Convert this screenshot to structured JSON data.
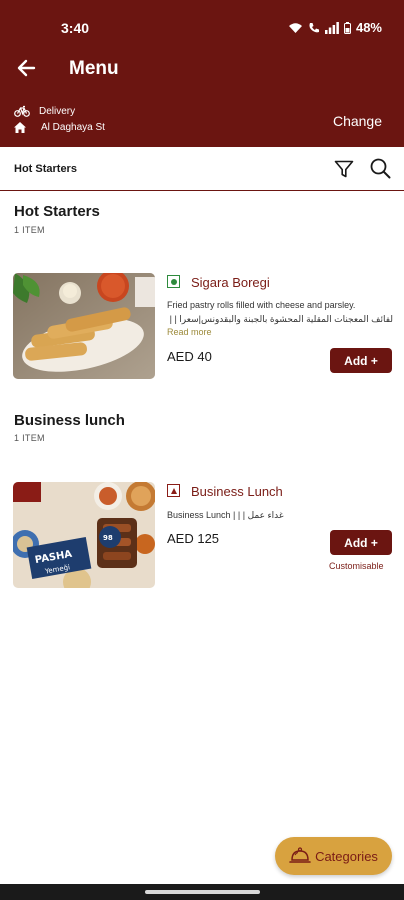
{
  "status_bar": {
    "time": "3:40",
    "battery": "48%"
  },
  "appbar": {
    "title": "Menu"
  },
  "delivery": {
    "mode": "Delivery",
    "address": "Al Daghaya St",
    "change_label": "Change"
  },
  "searchbar": {
    "label": "Hot Starters"
  },
  "sections": [
    {
      "title": "Hot Starters",
      "count": "1 ITEM",
      "item": {
        "name": "Sigara Boregi",
        "diet": "veg",
        "desc_line1": "Fried pastry rolls filled with cheese and parsley.",
        "desc_line2": "لفائف المعجنات المقلية المحشوة بالجبنة والبقدونس|سعرا | | |",
        "read_more": "Read more",
        "price": "AED 40",
        "add_label": "Add +"
      }
    },
    {
      "title": "Business lunch",
      "count": "1 ITEM",
      "item": {
        "name": "Business Lunch",
        "diet": "non-veg",
        "desc_line1": "Business Lunch | | | غداء عمل",
        "price": "AED 125",
        "add_label": "Add +",
        "note": "Customisable",
        "image_text": "PASHA Yemeği"
      }
    }
  ],
  "categories_label": "Categories",
  "colors": {
    "brand": "#6b1511",
    "accent": "#d8a23f",
    "veg": "#2e8b3d"
  }
}
